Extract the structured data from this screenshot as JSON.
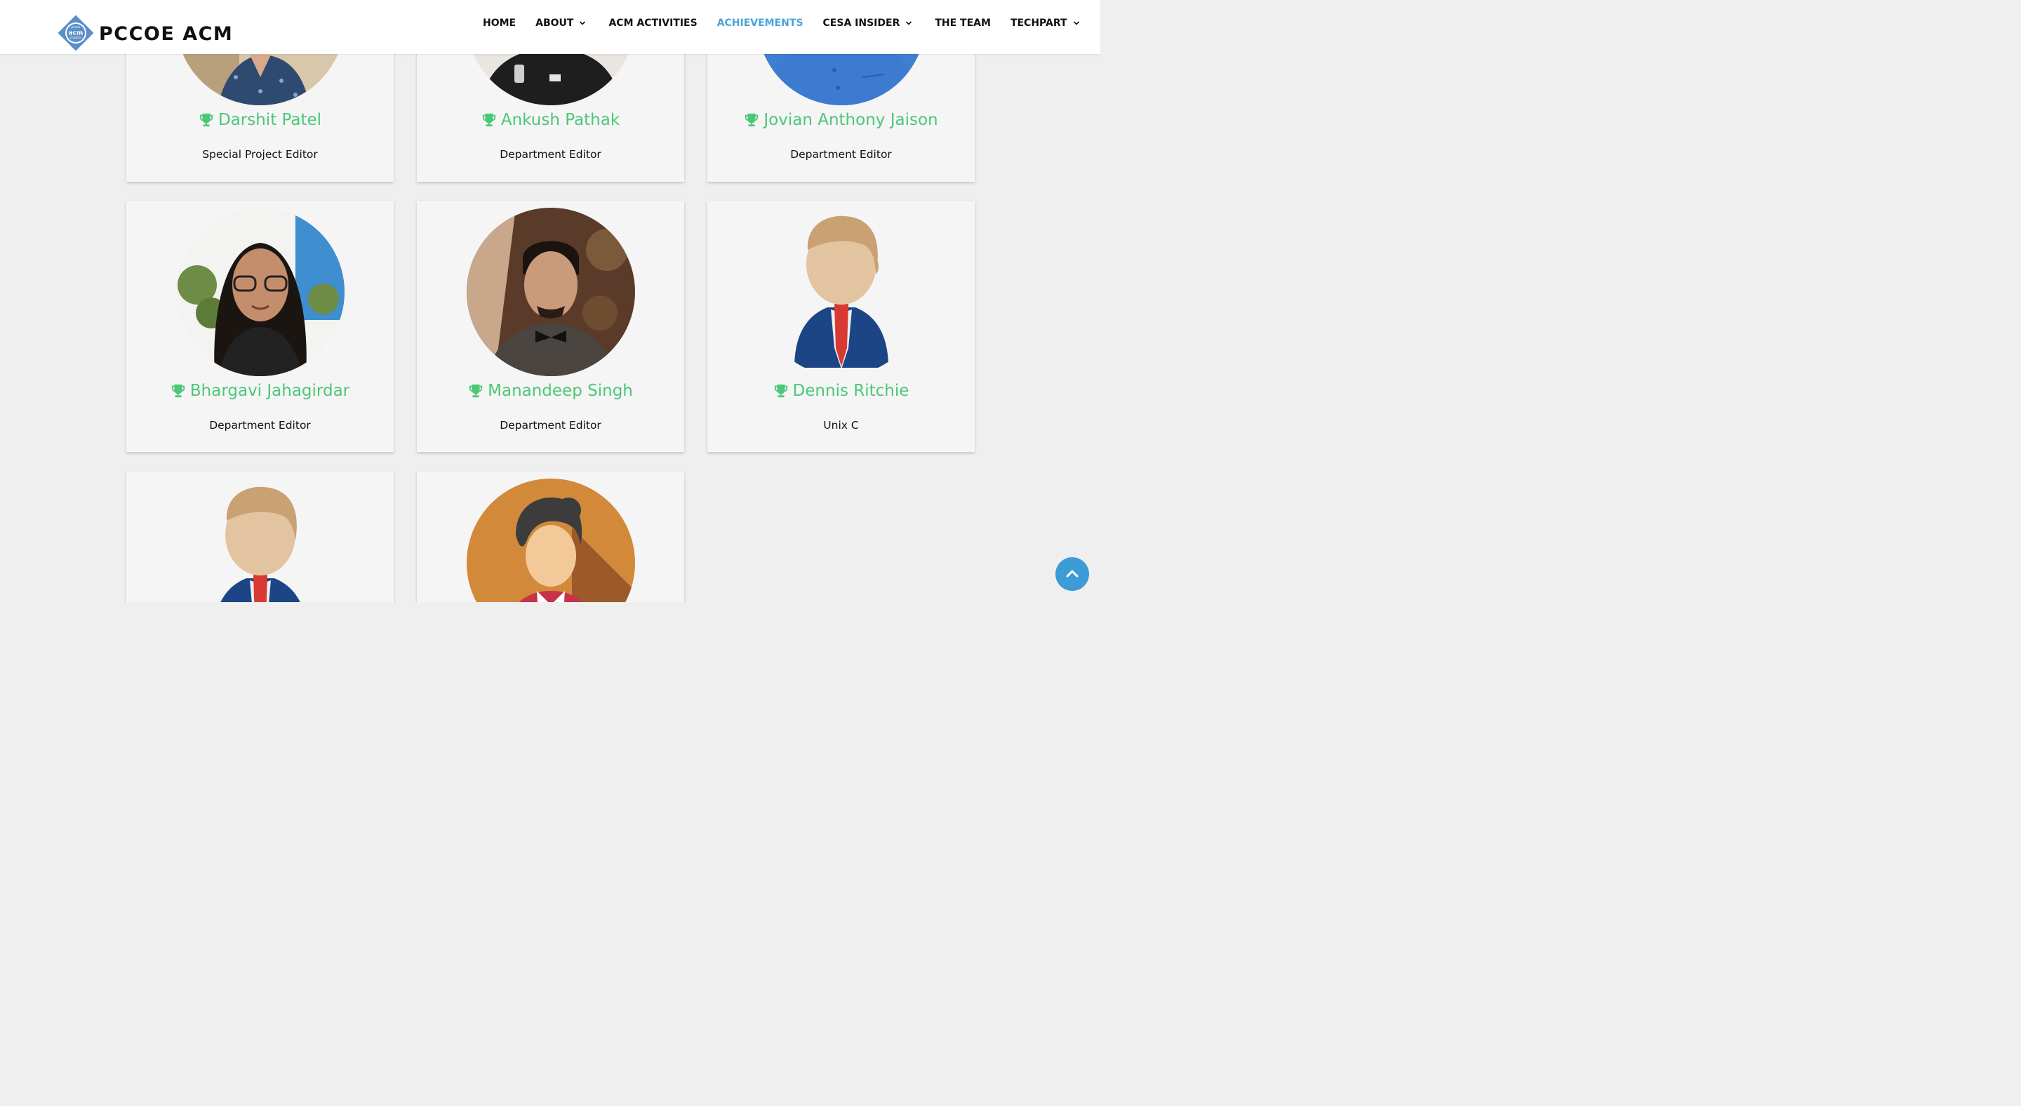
{
  "header": {
    "logo_text": "PCCOE ACM",
    "logo_mark_lines": [
      "pccoe",
      "acm",
      "chapter"
    ],
    "nav": [
      {
        "label": "HOME",
        "dropdown": false,
        "active": false
      },
      {
        "label": "ABOUT",
        "dropdown": true,
        "active": false
      },
      {
        "label": "ACM ACTIVITIES",
        "dropdown": false,
        "active": false
      },
      {
        "label": "ACHIEVEMENTS",
        "dropdown": false,
        "active": true
      },
      {
        "label": "CESA INSIDER",
        "dropdown": true,
        "active": false
      },
      {
        "label": "THE TEAM",
        "dropdown": false,
        "active": false
      },
      {
        "label": "TECHPART",
        "dropdown": true,
        "active": false
      }
    ]
  },
  "members": [
    {
      "name": "Darshit Patel",
      "role": "Special Project Editor",
      "photo": "photo-man-patterned-shirt"
    },
    {
      "name": "Ankush Pathak",
      "role": "Department Editor",
      "photo": "photo-man-black-polo"
    },
    {
      "name": "Jovian Anthony Jaison",
      "role": "Department Editor",
      "photo": "photo-man-blue-shirt"
    },
    {
      "name": "Bhargavi Jahagirdar",
      "role": "Department Editor",
      "photo": "photo-woman-glasses"
    },
    {
      "name": "Manandeep Singh",
      "role": "Department Editor",
      "photo": "photo-man-bowtie"
    },
    {
      "name": "Dennis Ritchie",
      "role": "Unix C",
      "photo": "avatar-businessman-icon"
    },
    {
      "name": "",
      "role": "",
      "photo": "avatar-businessman-icon"
    },
    {
      "name": "",
      "role": "",
      "photo": "avatar-woman-icon"
    }
  ],
  "colors": {
    "accent_green": "#4cc777",
    "nav_active": "#4aa3d8",
    "scroll_button": "#3d9bd6"
  },
  "scroll_top_icon": "chevron-up-icon"
}
